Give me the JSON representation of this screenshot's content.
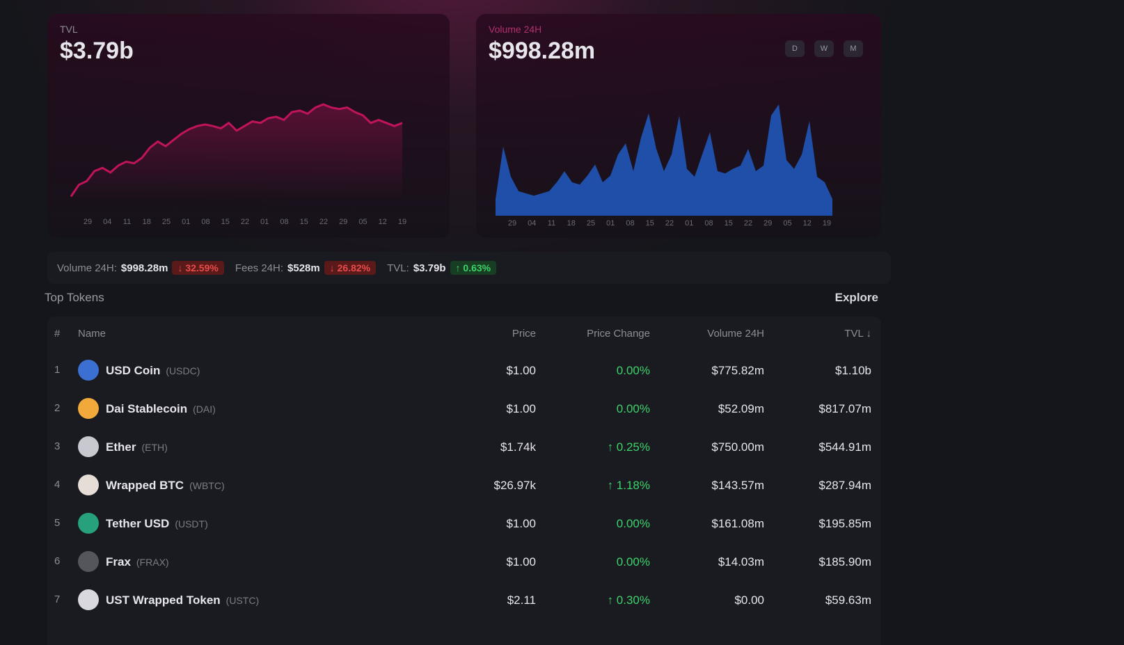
{
  "tvl_card": {
    "label": "TVL",
    "value": "$3.79b",
    "x_ticks": [
      "29",
      "04",
      "11",
      "18",
      "25",
      "01",
      "08",
      "15",
      "22",
      "01",
      "08",
      "15",
      "22",
      "29",
      "05",
      "12",
      "19"
    ],
    "series_color": "#c0145a"
  },
  "volume_card": {
    "label": "Volume 24H",
    "value": "$998.28m",
    "range_buttons": [
      "D",
      "W",
      "M"
    ],
    "x_ticks": [
      "29",
      "04",
      "11",
      "18",
      "25",
      "01",
      "08",
      "15",
      "22",
      "01",
      "08",
      "15",
      "22",
      "29",
      "05",
      "12",
      "19"
    ],
    "series_color": "#1f4fa8"
  },
  "stats_bar": {
    "volume": {
      "label": "Volume 24H:",
      "value": "$998.28m",
      "change": "↓ 32.59%"
    },
    "fees": {
      "label": "Fees 24H:",
      "value": "$528m",
      "change": "↓ 26.82%"
    },
    "tvl": {
      "label": "TVL:",
      "value": "$3.79b",
      "change": "↑ 0.63%"
    }
  },
  "tokens_section": {
    "title": "Top Tokens",
    "explore": "Explore",
    "columns": {
      "index": "#",
      "name": "Name",
      "price": "Price",
      "change": "Price Change",
      "volume": "Volume 24H",
      "tvl": "TVL ↓"
    },
    "rows": [
      {
        "index": "1",
        "name": "USD Coin",
        "symbol": "(USDC)",
        "price": "$1.00",
        "change": "0.00%",
        "volume": "$775.82m",
        "tvl": "$1.10b",
        "icon_color": "#3b6fd1",
        "icon": "usdc-icon"
      },
      {
        "index": "2",
        "name": "Dai Stablecoin",
        "symbol": "(DAI)",
        "price": "$1.00",
        "change": "0.00%",
        "volume": "$52.09m",
        "tvl": "$817.07m",
        "icon_color": "#f2a93b",
        "icon": "dai-icon"
      },
      {
        "index": "3",
        "name": "Ether",
        "symbol": "(ETH)",
        "price": "$1.74k",
        "change": "↑ 0.25%",
        "volume": "$750.00m",
        "tvl": "$544.91m",
        "icon_color": "#c8c8d0",
        "icon": "eth-icon"
      },
      {
        "index": "4",
        "name": "Wrapped BTC",
        "symbol": "(WBTC)",
        "price": "$26.97k",
        "change": "↑ 1.18%",
        "volume": "$143.57m",
        "tvl": "$287.94m",
        "icon_color": "#e6ddd6",
        "icon": "wbtc-icon"
      },
      {
        "index": "5",
        "name": "Tether USD",
        "symbol": "(USDT)",
        "price": "$1.00",
        "change": "0.00%",
        "volume": "$161.08m",
        "tvl": "$195.85m",
        "icon_color": "#26a17b",
        "icon": "usdt-icon"
      },
      {
        "index": "6",
        "name": "Frax",
        "symbol": "(FRAX)",
        "price": "$1.00",
        "change": "0.00%",
        "volume": "$14.03m",
        "tvl": "$185.90m",
        "icon_color": "#55555c",
        "icon": "frax-icon"
      },
      {
        "index": "7",
        "name": "UST Wrapped Token",
        "symbol": "(USTC)",
        "price": "$2.11",
        "change": "↑ 0.30%",
        "volume": "$0.00",
        "tvl": "$59.63m",
        "icon_color": "#d8d8de",
        "icon": "ust-icon"
      }
    ]
  }
}
